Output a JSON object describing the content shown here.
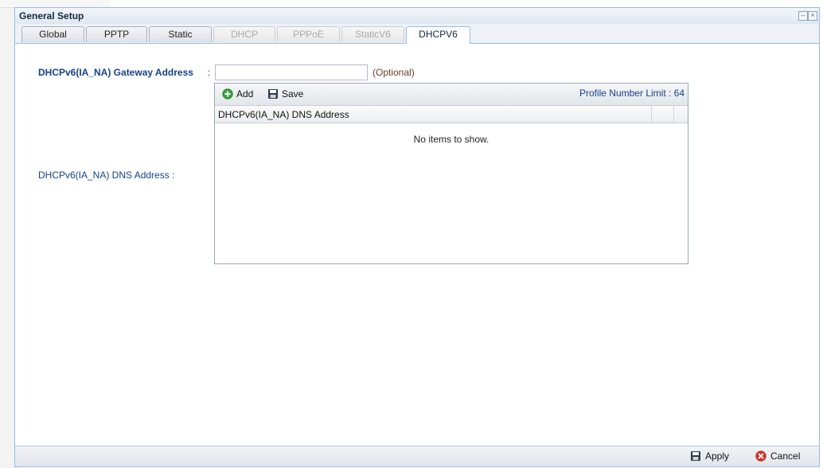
{
  "window": {
    "title": "General Setup",
    "minimize": "–",
    "close": "×"
  },
  "tabs": [
    {
      "label": "Global",
      "state": "normal"
    },
    {
      "label": "PPTP",
      "state": "normal"
    },
    {
      "label": "Static",
      "state": "normal"
    },
    {
      "label": "DHCP",
      "state": "disabled"
    },
    {
      "label": "PPPoE",
      "state": "disabled"
    },
    {
      "label": "StaticV6",
      "state": "disabled"
    },
    {
      "label": "DHCPV6",
      "state": "active"
    }
  ],
  "form": {
    "gateway_label": "DHCPv6(IA_NA) Gateway Address",
    "colon": ":",
    "gateway_value": "",
    "optional_hint": "(Optional)",
    "dns_label": "DHCPv6(IA_NA) DNS Address :"
  },
  "grid": {
    "add_label": "Add",
    "save_label": "Save",
    "limit_label": "Profile Number Limit : 64",
    "column_header": "DHCPv6(IA_NA) DNS Address",
    "empty_text": "No items to show."
  },
  "footer": {
    "apply_label": "Apply",
    "cancel_label": "Cancel"
  },
  "colors": {
    "accent": "#15428b",
    "border": "#99bbe8",
    "add_icon": "#3aa23a",
    "cancel_icon": "#d9342b"
  },
  "icons": [
    "add-icon",
    "save-icon",
    "apply-icon",
    "cancel-icon",
    "minimize-icon",
    "close-icon"
  ]
}
